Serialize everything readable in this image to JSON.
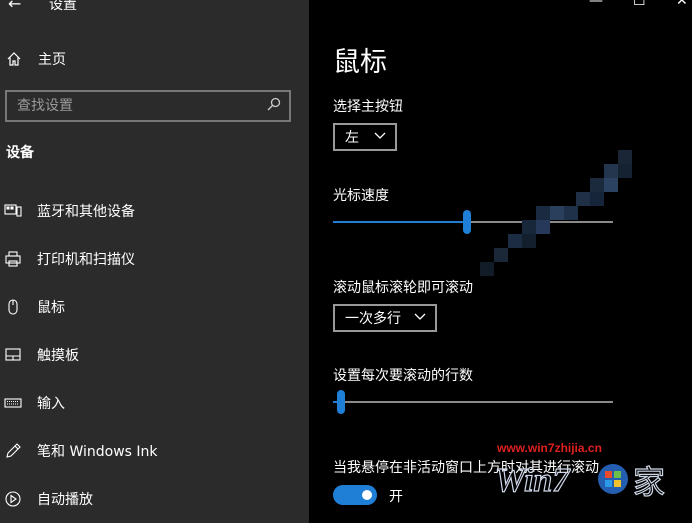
{
  "window": {
    "title": "设置",
    "back_glyph": "←",
    "min_glyph": "—",
    "max_glyph": "☐",
    "close_glyph": "✕"
  },
  "sidebar": {
    "home_label": "主页",
    "search_placeholder": "查找设置",
    "section_title": "设备",
    "items": [
      {
        "label": "蓝牙和其他设备",
        "icon": "bluetooth-devices-icon"
      },
      {
        "label": "打印机和扫描仪",
        "icon": "printer-icon"
      },
      {
        "label": "鼠标",
        "icon": "mouse-icon"
      },
      {
        "label": "触摸板",
        "icon": "touchpad-icon"
      },
      {
        "label": "输入",
        "icon": "keyboard-icon"
      },
      {
        "label": "笔和 Windows Ink",
        "icon": "pen-icon"
      },
      {
        "label": "自动播放",
        "icon": "autoplay-icon"
      }
    ]
  },
  "main": {
    "title": "鼠标",
    "primary_button_label": "选择主按钮",
    "primary_button_value": "左",
    "cursor_speed_label": "光标速度",
    "cursor_speed_fraction": 0.48,
    "scroll_label": "滚动鼠标滚轮即可滚动",
    "scroll_value": "一次多行",
    "lines_label": "设置每次要滚动的行数",
    "lines_fraction": 0.03,
    "inactive_scroll_label": "当我悬停在非活动窗口上方时对其进行滚动",
    "toggle_on": true,
    "toggle_label": "开"
  },
  "watermark": {
    "url": "www.win7zhijia.cn"
  },
  "colors": {
    "sidebar_bg": "#2b2b2b",
    "main_bg": "#000000",
    "accent": "#1f7fd6",
    "watermark": "#e02020"
  }
}
